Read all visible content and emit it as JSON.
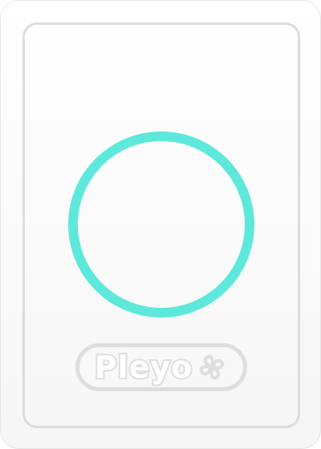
{
  "card": {
    "logo_text": "Pleyo",
    "logo_mark": "pinwheel-icon",
    "ring_color": "#5EE8DC",
    "logo_color": "#DEDEDE",
    "frame_color": "#DCDCDC"
  }
}
